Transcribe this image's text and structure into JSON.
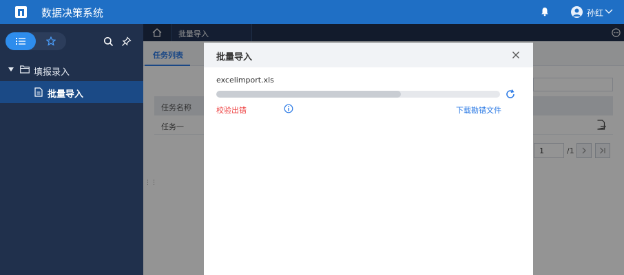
{
  "app": {
    "title": "数据决策系统",
    "username": "孙红"
  },
  "sidebar": {
    "tree_parent_label": "填报录入",
    "tree_child_label": "批量导入"
  },
  "tabs": {
    "active_label": "批量导入"
  },
  "subtab": {
    "label": "任务列表"
  },
  "table": {
    "header": "任务名称",
    "row_name": "任务一"
  },
  "pager": {
    "current_page": "1",
    "total": "/1"
  },
  "modal": {
    "title": "批量导入",
    "file_name": "excelimport.xls",
    "progress": 0.65,
    "status_text": "校验出错",
    "download_link": "下载勘错文件"
  },
  "colors": {
    "header_bg": "#1f6fc5",
    "sidebar_bg": "#20304c",
    "accent": "#2d7be5",
    "error": "#ee4343"
  },
  "icons": [
    "logo-icon",
    "bell-icon",
    "user-avatar-icon",
    "chevron-down-icon",
    "list-icon",
    "star-icon",
    "search-icon",
    "pin-icon",
    "folder-icon",
    "file-icon",
    "home-icon",
    "more-icon",
    "export-icon",
    "close-icon",
    "refresh-icon",
    "info-icon"
  ]
}
